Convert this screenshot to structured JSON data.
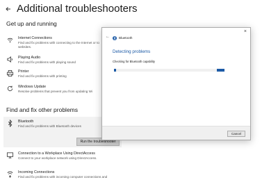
{
  "header": {
    "title": "Additional troubleshooters"
  },
  "sections": {
    "get_up_running": "Get up and running",
    "find_fix_other": "Find and fix other problems"
  },
  "items": {
    "internet": {
      "title": "Internet Connections",
      "desc": "Find and fix problems with connecting to the Internet or to websites."
    },
    "audio": {
      "title": "Playing Audio",
      "desc": "Find and fix problems with playing sound"
    },
    "printer": {
      "title": "Printer",
      "desc": "Find and fix problems with printing"
    },
    "update": {
      "title": "Windows Update",
      "desc": "Resolve problems that prevent you from updating Wi"
    },
    "bluetooth": {
      "title": "Bluetooth",
      "desc": "Find and fix problems with Bluetooth devices"
    },
    "directaccess": {
      "title": "Connection to a Workplace Using DirectAccess",
      "desc": "Connect to your workplace network using DirectAccess."
    },
    "incoming": {
      "title": "Incoming Connections",
      "desc": "Find and fix problems with incoming computer connections and"
    }
  },
  "run_button": "Run the troubleshooter",
  "dialog": {
    "title": "Bluetooth",
    "heading": "Detecting problems",
    "status": "Checking for Bluetooth capability",
    "cancel": "Cancel",
    "close_glyph": "×",
    "back_glyph": "←"
  },
  "colors": {
    "accent": "#1c5aa6"
  },
  "icons": {
    "back": "back-arrow-icon",
    "internet": "wifi-icon",
    "audio": "speaker-icon",
    "printer": "printer-icon",
    "update": "refresh-icon",
    "bluetooth": "bluetooth-icon",
    "directaccess": "workplace-connection-icon",
    "incoming": "incoming-connection-icon"
  }
}
